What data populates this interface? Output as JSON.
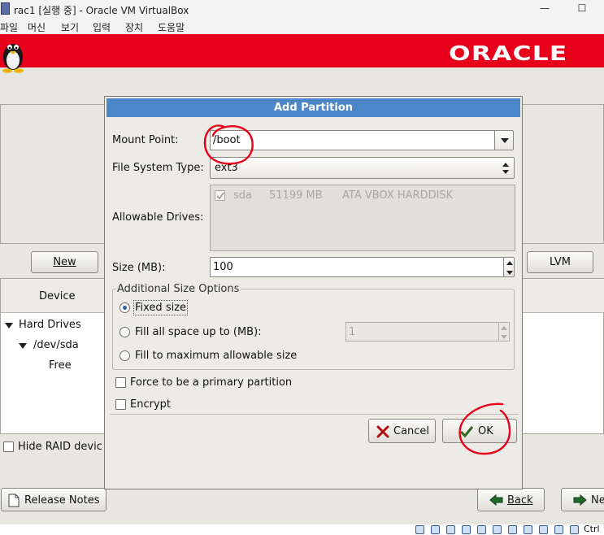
{
  "window": {
    "title": "rac1 [실행 중] - Oracle VM VirtualBox",
    "minimize_glyph": "—",
    "maximize_glyph": "☐"
  },
  "menubar": [
    "파일",
    "머신",
    "보기",
    "입력",
    "장치",
    "도움말"
  ],
  "installer": {
    "brand": "ORACLE",
    "new_button": "New",
    "lvm_button": "LVM",
    "device_column": "Device",
    "tree": {
      "hard_drives": "Hard Drives",
      "dev": "/dev/sda",
      "free": "Free"
    },
    "hide_raid": "Hide RAID devic",
    "release_notes": "Release Notes",
    "back": "Back",
    "next": "Ne"
  },
  "dialog": {
    "title": "Add Partition",
    "mount_point_label": "Mount Point:",
    "mount_point_value": "/boot",
    "fs_type_label": "File System Type:",
    "fs_type_value": "ext3",
    "allowable_drives_label": "Allowable Drives:",
    "drives": [
      {
        "checked": true,
        "name": "sda",
        "size": "51199 MB",
        "model": "ATA VBOX HARDDISK"
      }
    ],
    "size_label": "Size (MB):",
    "size_value": "100",
    "additional_group": "Additional Size Options",
    "options": [
      {
        "label": "Fixed size",
        "selected": true
      },
      {
        "label": "Fill all space up to (MB):",
        "selected": false
      },
      {
        "label": "Fill to maximum allowable size",
        "selected": false
      }
    ],
    "fill_upto_value": "1",
    "primary_label": "Force to be a primary partition",
    "encrypt_label": "Encrypt",
    "cancel_label": "Cancel",
    "ok_label": "OK"
  },
  "host": {
    "ctrl_label": "Ctrl"
  },
  "colors": {
    "banner": "#e6001c",
    "dialog_title": "#4b87c8",
    "annotation": "#e8001a"
  }
}
